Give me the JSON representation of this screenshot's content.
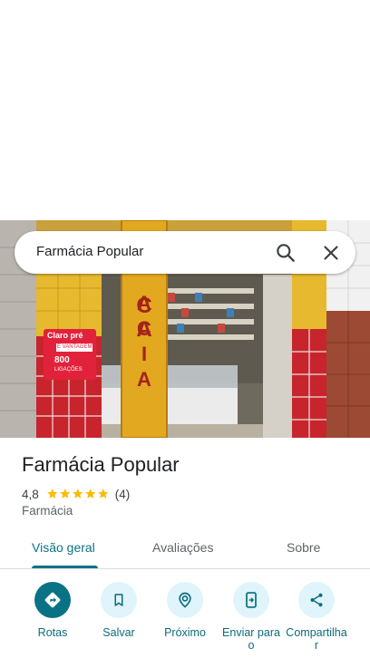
{
  "search": {
    "query": "Farmácia Popular",
    "search_icon": "search-icon",
    "close_icon": "close-icon"
  },
  "place": {
    "name": "Farmácia Popular",
    "rating": "4,8",
    "stars": 5,
    "review_count": "(4)",
    "category": "Farmácia"
  },
  "photo": {
    "sign_text": "ACIA",
    "poster_brand": "Claro pré",
    "poster_line1": "É VANTAGEM",
    "poster_amount": "800",
    "poster_line2": "LIGAÇÕES"
  },
  "tabs": [
    {
      "label": "Visão geral",
      "active": true
    },
    {
      "label": "Avaliações",
      "active": false
    },
    {
      "label": "Sobre",
      "active": false
    }
  ],
  "actions": [
    {
      "label_line1": "Rotas",
      "label_line2": "",
      "icon": "directions-icon"
    },
    {
      "label_line1": "Salvar",
      "label_line2": "",
      "icon": "bookmark-icon"
    },
    {
      "label_line1": "Próximo",
      "label_line2": "",
      "icon": "nearby-icon"
    },
    {
      "label_line1": "Enviar para",
      "label_line2": "o",
      "icon": "send-to-phone-icon"
    },
    {
      "label_line1": "Compartilha",
      "label_line2": "r",
      "icon": "share-icon"
    }
  ],
  "colors": {
    "accent": "#0b7285",
    "star": "#fbbc04",
    "action_bg": "#dff4fb"
  }
}
